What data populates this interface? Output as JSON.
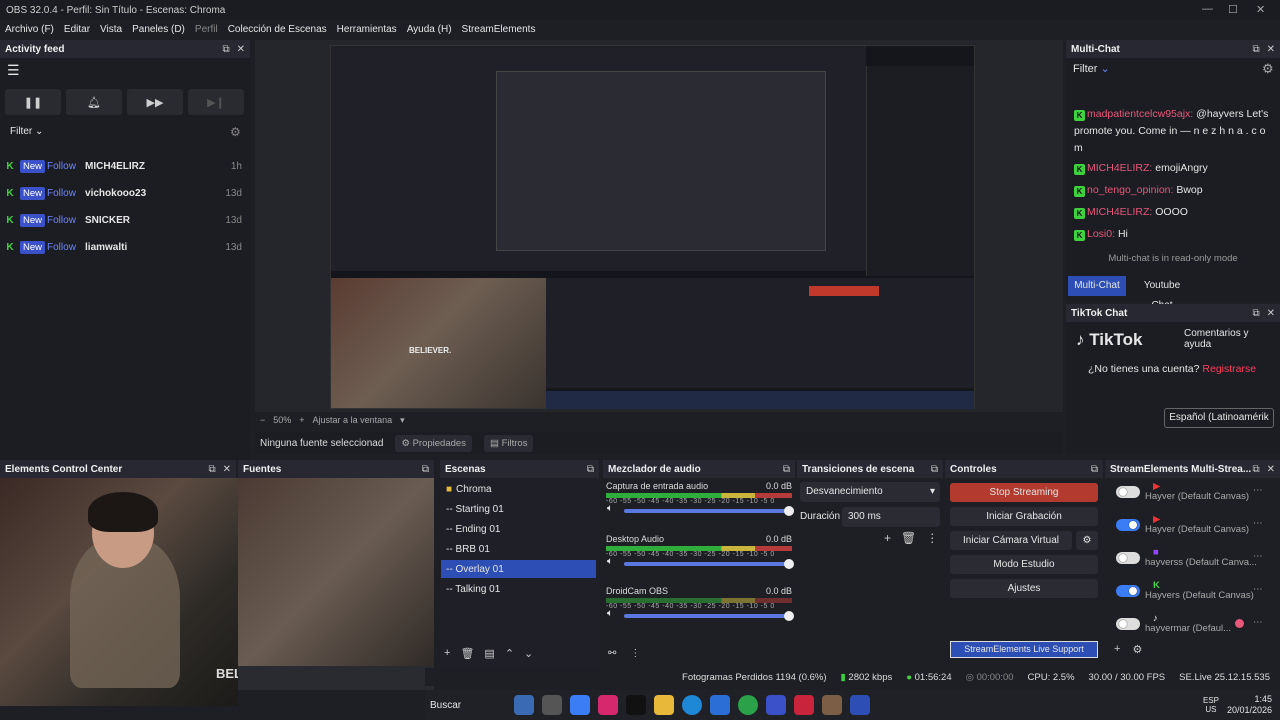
{
  "window": {
    "title": "OBS 32.0.4 - Perfil: Sin Título - Escenas: Chroma"
  },
  "menu": [
    "Archivo (F)",
    "Editar",
    "Vista",
    "Paneles (D)",
    "Perfil",
    "Colección de Escenas",
    "Herramientas",
    "Ayuda (H)",
    "StreamElements"
  ],
  "activity": {
    "title": "Activity feed",
    "filter": "Filter",
    "items": [
      {
        "badge": "New",
        "type": "Follow",
        "name": "MICH4ELIRZ",
        "time": "1h"
      },
      {
        "badge": "New",
        "type": "Follow",
        "name": "vichokooo23",
        "time": "13d"
      },
      {
        "badge": "New",
        "type": "Follow",
        "name": "SNICKER",
        "time": "13d"
      },
      {
        "badge": "New",
        "type": "Follow",
        "name": "liamwalti",
        "time": "13d"
      }
    ]
  },
  "preview": {
    "zoom": "50%",
    "fit": "Ajustar a la ventana",
    "no_source": "Ninguna fuente seleccionad",
    "properties": "Propiedades",
    "filters": "Filtros",
    "webcam_shirt": "BELIEVER."
  },
  "multichat": {
    "title": "Multi-Chat",
    "filter": "Filter",
    "messages": [
      {
        "user": "madpatientcelcw95ajx:",
        "text": "@hayvers Let's promote you. Come in — n e z h n a . c o m"
      },
      {
        "user": "MICH4ELIRZ:",
        "text": "emojiAngry"
      },
      {
        "user": "no_tengo_opinion:",
        "text": "Bwop"
      },
      {
        "user": "MICH4ELIRZ:",
        "text": "OOOO"
      },
      {
        "user": "Losi0:",
        "text": "Hi"
      }
    ],
    "readonly": "Multi-chat is in read-only mode",
    "tabs": [
      "Multi-Chat",
      "Youtube Chat"
    ]
  },
  "tiktok": {
    "title": "TikTok Chat",
    "brand": "TikTok",
    "tagline": "Comentarios y ayuda",
    "question": "¿No tienes una cuenta?",
    "register": "Registrarse",
    "lang": "Español (Latinoamérik"
  },
  "docks": {
    "ecc": "Elements Control Center",
    "fuentes": "Fuentes",
    "escenas": "Escenas",
    "mezclador": "Mezclador de audio",
    "transiciones": "Transiciones de escena",
    "controles": "Controles",
    "se": "StreamElements Multi-Strea..."
  },
  "scenes": [
    "Chroma",
    "-- Starting 01",
    "-- Ending 01",
    "-- BRB 01",
    "-- Overlay 01",
    "-- Talking 01"
  ],
  "mixer": [
    {
      "name": "Captura de entrada audio",
      "db": "0.0 dB"
    },
    {
      "name": "Desktop Audio",
      "db": "0.0 dB"
    },
    {
      "name": "DroidCam OBS",
      "db": "0.0 dB"
    }
  ],
  "mixer_ticks": "-60 -55 -50 -45 -40 -35 -30 -25 -20 -15 -10 -5 0",
  "transitions": {
    "type": "Desvanecimiento",
    "duration_label": "Duración",
    "duration": "300 ms"
  },
  "controls": [
    "Stop Streaming",
    "Iniciar Grabación",
    "Iniciar Cámara Virtual",
    "Modo Estudio",
    "Ajustes"
  ],
  "se_items": [
    {
      "name": "Hayver (Default Canvas)",
      "on": false
    },
    {
      "name": "Hayver (Default Canvas)",
      "on": true
    },
    {
      "name": "hayverss (Default Canva...",
      "on": false
    },
    {
      "name": "Hayvers (Default Canvas)",
      "on": true
    },
    {
      "name": "hayvermar (Defaul...",
      "on": false
    }
  ],
  "se_support": "StreamElements Live Support",
  "status": {
    "dropped": "Fotogramas Perdidos 1194 (0.6%)",
    "kbps": "2802 kbps",
    "time": "01:56:24",
    "rec": "00:00:00",
    "cpu": "CPU: 2.5%",
    "fps": "30.00 / 30.00 FPS",
    "version": "SE.Live 25.12.15.535"
  },
  "taskbar": {
    "search": "Buscar",
    "lang": "ESP\nUS",
    "clock": "1:45",
    "date": "20/01/2026"
  }
}
